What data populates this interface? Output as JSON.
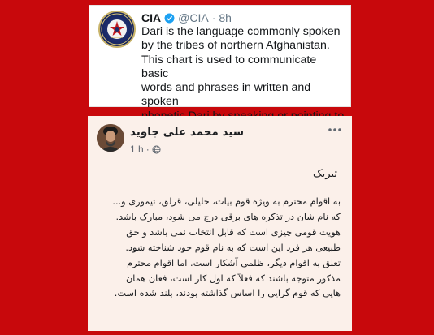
{
  "tweet": {
    "name": "CIA",
    "handle": "@CIA",
    "separator": "·",
    "time": "8h",
    "verified_icon": "verified-badge-icon",
    "avatar_icon": "cia-seal",
    "text": "Dari is the language commonly spoken\nby the tribes of northern Afghanistan.\nThis chart is used to communicate basic\nwords and phrases in written and spoken\nphonetic Dari by speaking or pointing to\nthe words printed on the chart."
  },
  "facebook_post": {
    "author": "سید محمد علی جاوید",
    "time": "1 h",
    "separator": "·",
    "audience_icon": "globe-icon",
    "more_icon": "more-options-icon",
    "greeting": "تبریک",
    "lines": [
      "به اقوام محترم به ویژه قوم بیات، خلیلی، قرلق، تیموری و...",
      "که نام شان در تذکره های برقی درج می شود، مبارک باشد.",
      "هویت قومی چیزی است که قابل انتخاب نمی باشد و حق",
      "طبیعی هر فرد این است که به نام قوم خود شناخته شود.",
      "تعلق به اقوام دیگر، ظلمی آشکار است. اما اقوام محترم",
      "مذکور متوجه باشند که فعلاً که اول کار است، فغان همان",
      "هایی که قوم گرایی را اساس گذاشته بودند، بلند شده است."
    ]
  },
  "colors": {
    "background": "#c8080c",
    "tweet_card": "#ffffff",
    "post_card": "#fbf0ea",
    "verified": "#1da1f2"
  }
}
